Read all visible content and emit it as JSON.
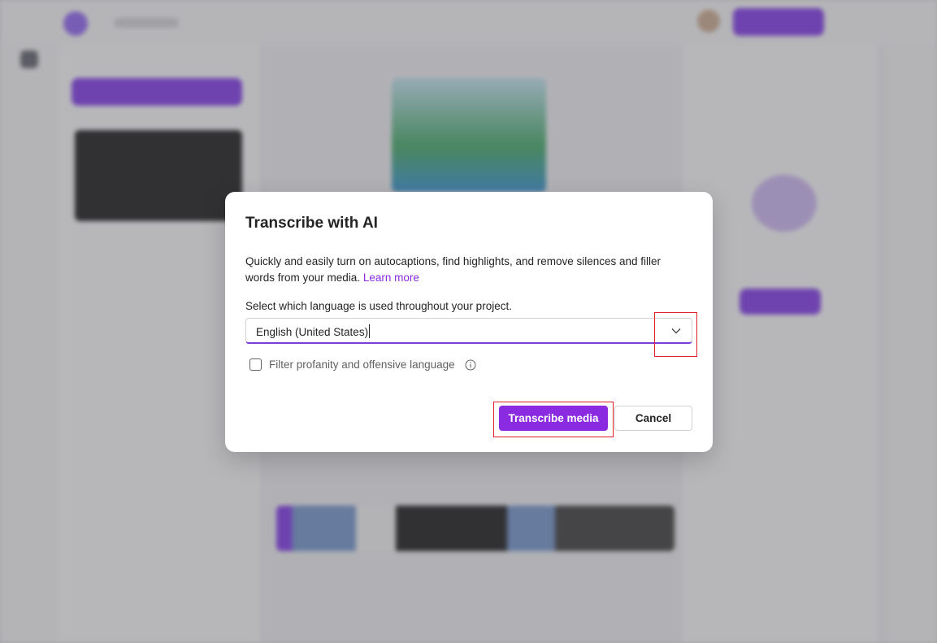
{
  "dialog": {
    "title": "Transcribe with AI",
    "description": "Quickly and easily turn on autocaptions, find highlights, and remove silences and filler words from your media.",
    "learn_more_label": "Learn more",
    "language_label": "Select which language is used throughout your project.",
    "language_value": "English (United States)",
    "profanity_label": "Filter profanity and offensive language",
    "profanity_checked": false,
    "primary_button": "Transcribe media",
    "secondary_button": "Cancel"
  },
  "colors": {
    "accent": "#8a2be2",
    "highlight": "#e0202a",
    "text": "#242424"
  },
  "icons": {
    "dropdown": "chevron-down-icon",
    "info": "info-icon"
  }
}
